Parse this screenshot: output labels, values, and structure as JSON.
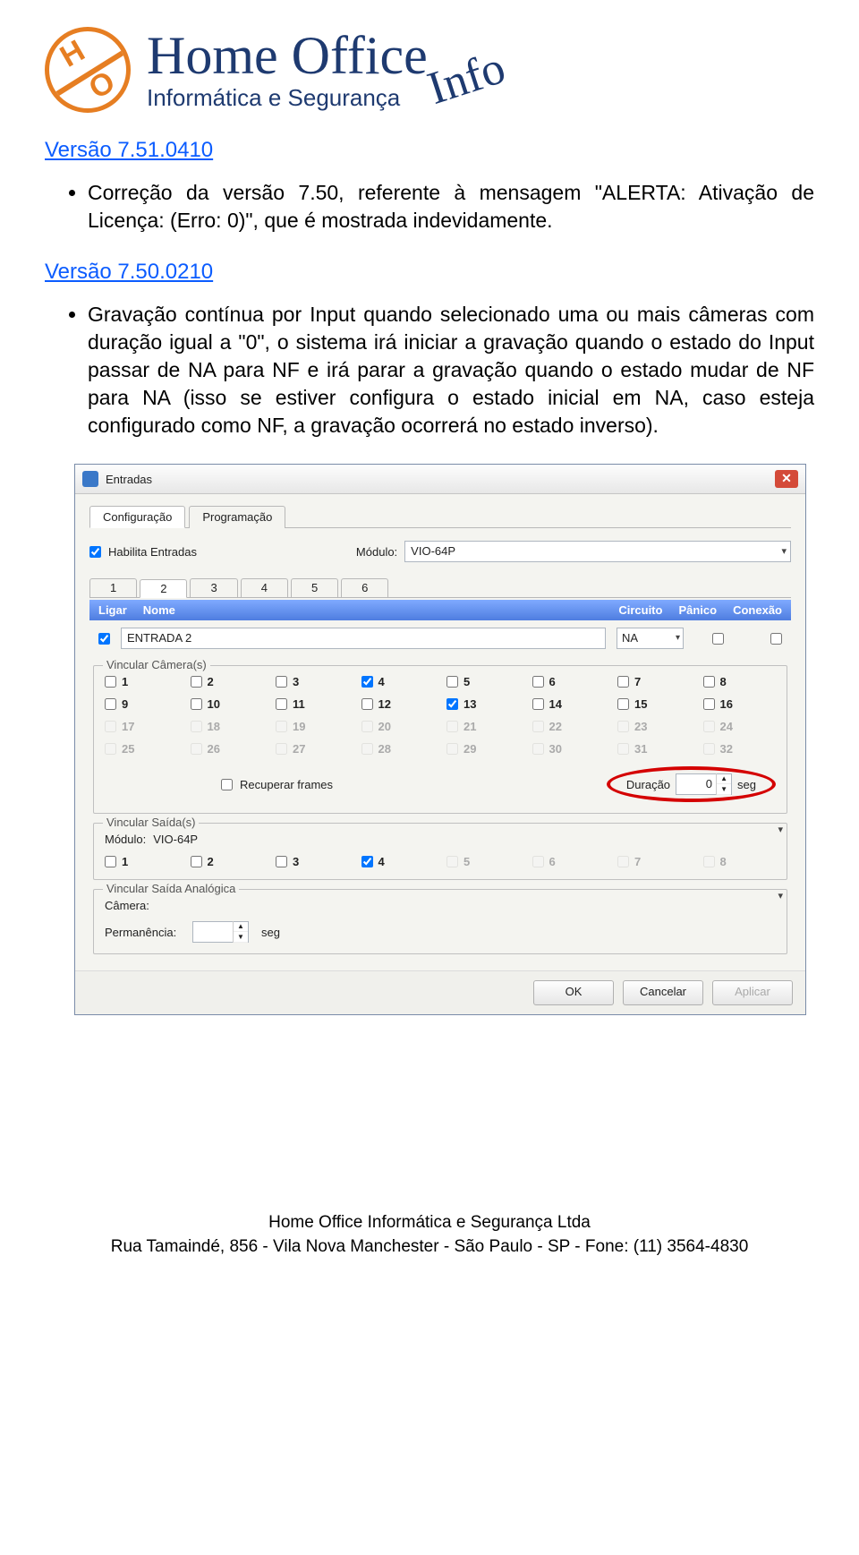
{
  "logo": {
    "line1": "Home Office",
    "line2": "Informática e Segurança",
    "script": "Info"
  },
  "sections": [
    {
      "version": "Versão 7.51.0410",
      "bullet": "Correção da versão 7.50, referente à mensagem \"ALERTA: Ativação de Licença: (Erro: 0)\", que é mostrada indevidamente."
    },
    {
      "version": "Versão 7.50.0210",
      "bullet": "Gravação contínua por Input quando selecionado uma ou mais câmeras com duração igual a \"0\", o sistema irá iniciar a gravação quando o estado do Input passar de NA para NF e irá parar a gravação quando o estado mudar de NF para NA (isso se estiver configura o estado inicial em NA, caso esteja configurado como NF, a gravação ocorrerá no estado inverso)."
    }
  ],
  "dialog": {
    "title": "Entradas",
    "tabs": {
      "config": "Configuração",
      "prog": "Programação"
    },
    "habilita": "Habilita Entradas",
    "modulo_label": "Módulo:",
    "modulo_value": "VIO-64P",
    "num_tabs": [
      "1",
      "2",
      "3",
      "4",
      "5",
      "6"
    ],
    "blue_head": {
      "c1": "Ligar",
      "c2": "Nome",
      "c3": "Circuito",
      "c4": "Pânico",
      "c5": "Conexão"
    },
    "entry_name": "ENTRADA 2",
    "circuito": "NA",
    "group_cameras": "Vincular Câmera(s)",
    "cams_checked": [
      4,
      13
    ],
    "cams_disabled_from": 17,
    "recup": "Recuperar frames",
    "dur_label": "Duração",
    "dur_val": "0",
    "dur_unit": "seg",
    "group_outs": "Vincular Saída(s)",
    "outs_modulo_label": "Módulo:",
    "outs_modulo_value": "VIO-64P",
    "outs_checked": [
      4
    ],
    "outs_disabled_from": 5,
    "group_analog": "Vincular Saída Analógica",
    "analog_cam_label": "Câmera:",
    "analog_perm_label": "Permanência:",
    "analog_perm_unit": "seg",
    "buttons": {
      "ok": "OK",
      "cancel": "Cancelar",
      "apply": "Aplicar"
    }
  },
  "footer": {
    "l1": "Home Office Informática e Segurança Ltda",
    "l2": "Rua Tamaindé, 856  -  Vila Nova Manchester  -  São Paulo  -  SP  -  Fone: (11) 3564-4830"
  }
}
